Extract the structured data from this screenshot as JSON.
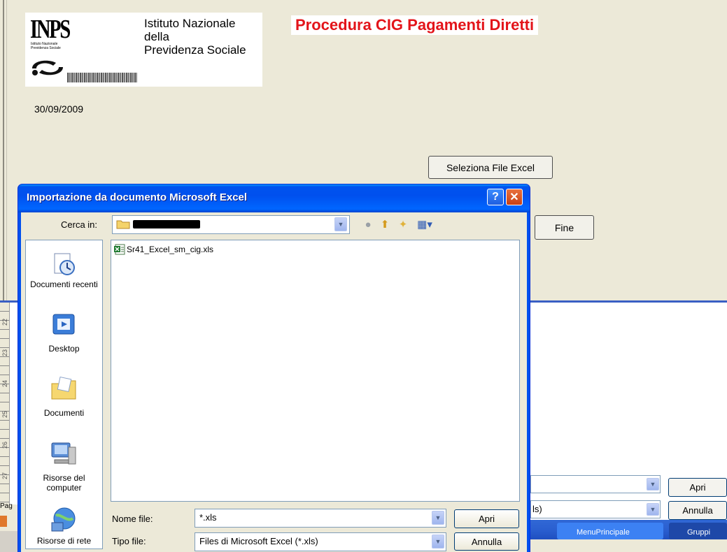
{
  "form": {
    "logo_mark": "INPS",
    "logo_small": "Istituto Nazionale Previdenza Sociale",
    "logo_line1": "Istituto Nazionale",
    "logo_line2": "della",
    "logo_line3": "Previdenza Sociale",
    "title": "Procedura CIG Pagamenti Diretti",
    "date": "30/09/2009",
    "select_button": "Seleziona File Excel",
    "end_button": "Fine",
    "title_color": "#e3141a"
  },
  "dialog": {
    "title": "Importazione da documento Microsoft Excel",
    "help_glyph": "?",
    "close_glyph": "✕",
    "look_in_label": "Cerca in:",
    "places": [
      {
        "label": "Documenti recenti",
        "icon": "recent-documents-icon"
      },
      {
        "label": "Desktop",
        "icon": "desktop-icon"
      },
      {
        "label": "Documenti",
        "icon": "documents-folder-icon"
      },
      {
        "label": "Risorse del computer",
        "icon": "my-computer-icon"
      },
      {
        "label": "Risorse di rete",
        "icon": "network-places-icon"
      }
    ],
    "files": [
      {
        "name": "Sr41_Excel_sm_cig.xls",
        "icon": "excel-file-icon"
      }
    ],
    "file_name_label": "Nome file:",
    "file_name_value": "*.xls",
    "file_type_label": "Tipo file:",
    "file_type_value": "Files di Microsoft Excel (*.xls)",
    "open_button": "Apri",
    "cancel_button": "Annulla",
    "accent_color": "#0053ee"
  },
  "background": {
    "pag_label": "Pag",
    "ruler_labels": [
      "22",
      "23",
      "24",
      "25",
      "26",
      "27"
    ],
    "type_value_fragment": "ls)",
    "open_button": "Apri",
    "cancel_button": "Annulla",
    "taskbar": [
      "MenuPrincipale",
      "Gruppi"
    ]
  }
}
